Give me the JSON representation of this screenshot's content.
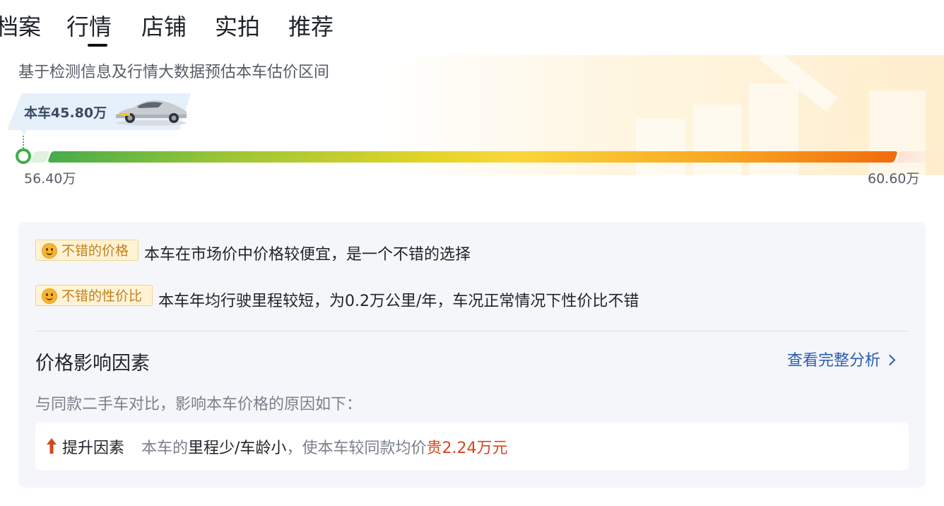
{
  "tabs": [
    {
      "label": "档案"
    },
    {
      "label": "行情"
    },
    {
      "label": "店铺"
    },
    {
      "label": "实拍"
    },
    {
      "label": "推荐"
    }
  ],
  "active_tab": "行情",
  "price_estimate": {
    "subtitle": "基于检测信息及行情大数据预估本车估价区间",
    "this_car_label": "本车45.80万",
    "min_label": "56.40万",
    "max_label": "60.60万",
    "this_car_value_wan": 45.8,
    "range_min_wan": 56.4,
    "range_max_wan": 60.6
  },
  "evaluations": [
    {
      "icon": "smile-icon",
      "tag": "不错的价格",
      "text": "本车在市场价中价格较便宜，是一个不错的选择"
    },
    {
      "icon": "smile-icon",
      "tag": "不错的性价比",
      "text": "本车年均行驶里程较短，为0.2万公里/年，车况正常情况下性价比不错"
    }
  ],
  "factors": {
    "title": "价格影响因素",
    "full_analysis_link": "查看完整分析",
    "description": "与同款二手车对比，影响本车价格的原因如下：",
    "item": {
      "icon": "arrow-up-icon",
      "label": "提升因素",
      "prefix": "本车的",
      "highlight": "里程少/车龄小",
      "middle": "，使本车较同款均价",
      "amount": "贵2.24万元"
    }
  },
  "colors": {
    "accent_link": "#2a5cb0",
    "price_up_red": "#d4471f",
    "range_start_green": "#45ad4a",
    "range_end_orange": "#f26b0d",
    "tag_bg": "#fff3d6",
    "tag_text": "#c2811d"
  }
}
